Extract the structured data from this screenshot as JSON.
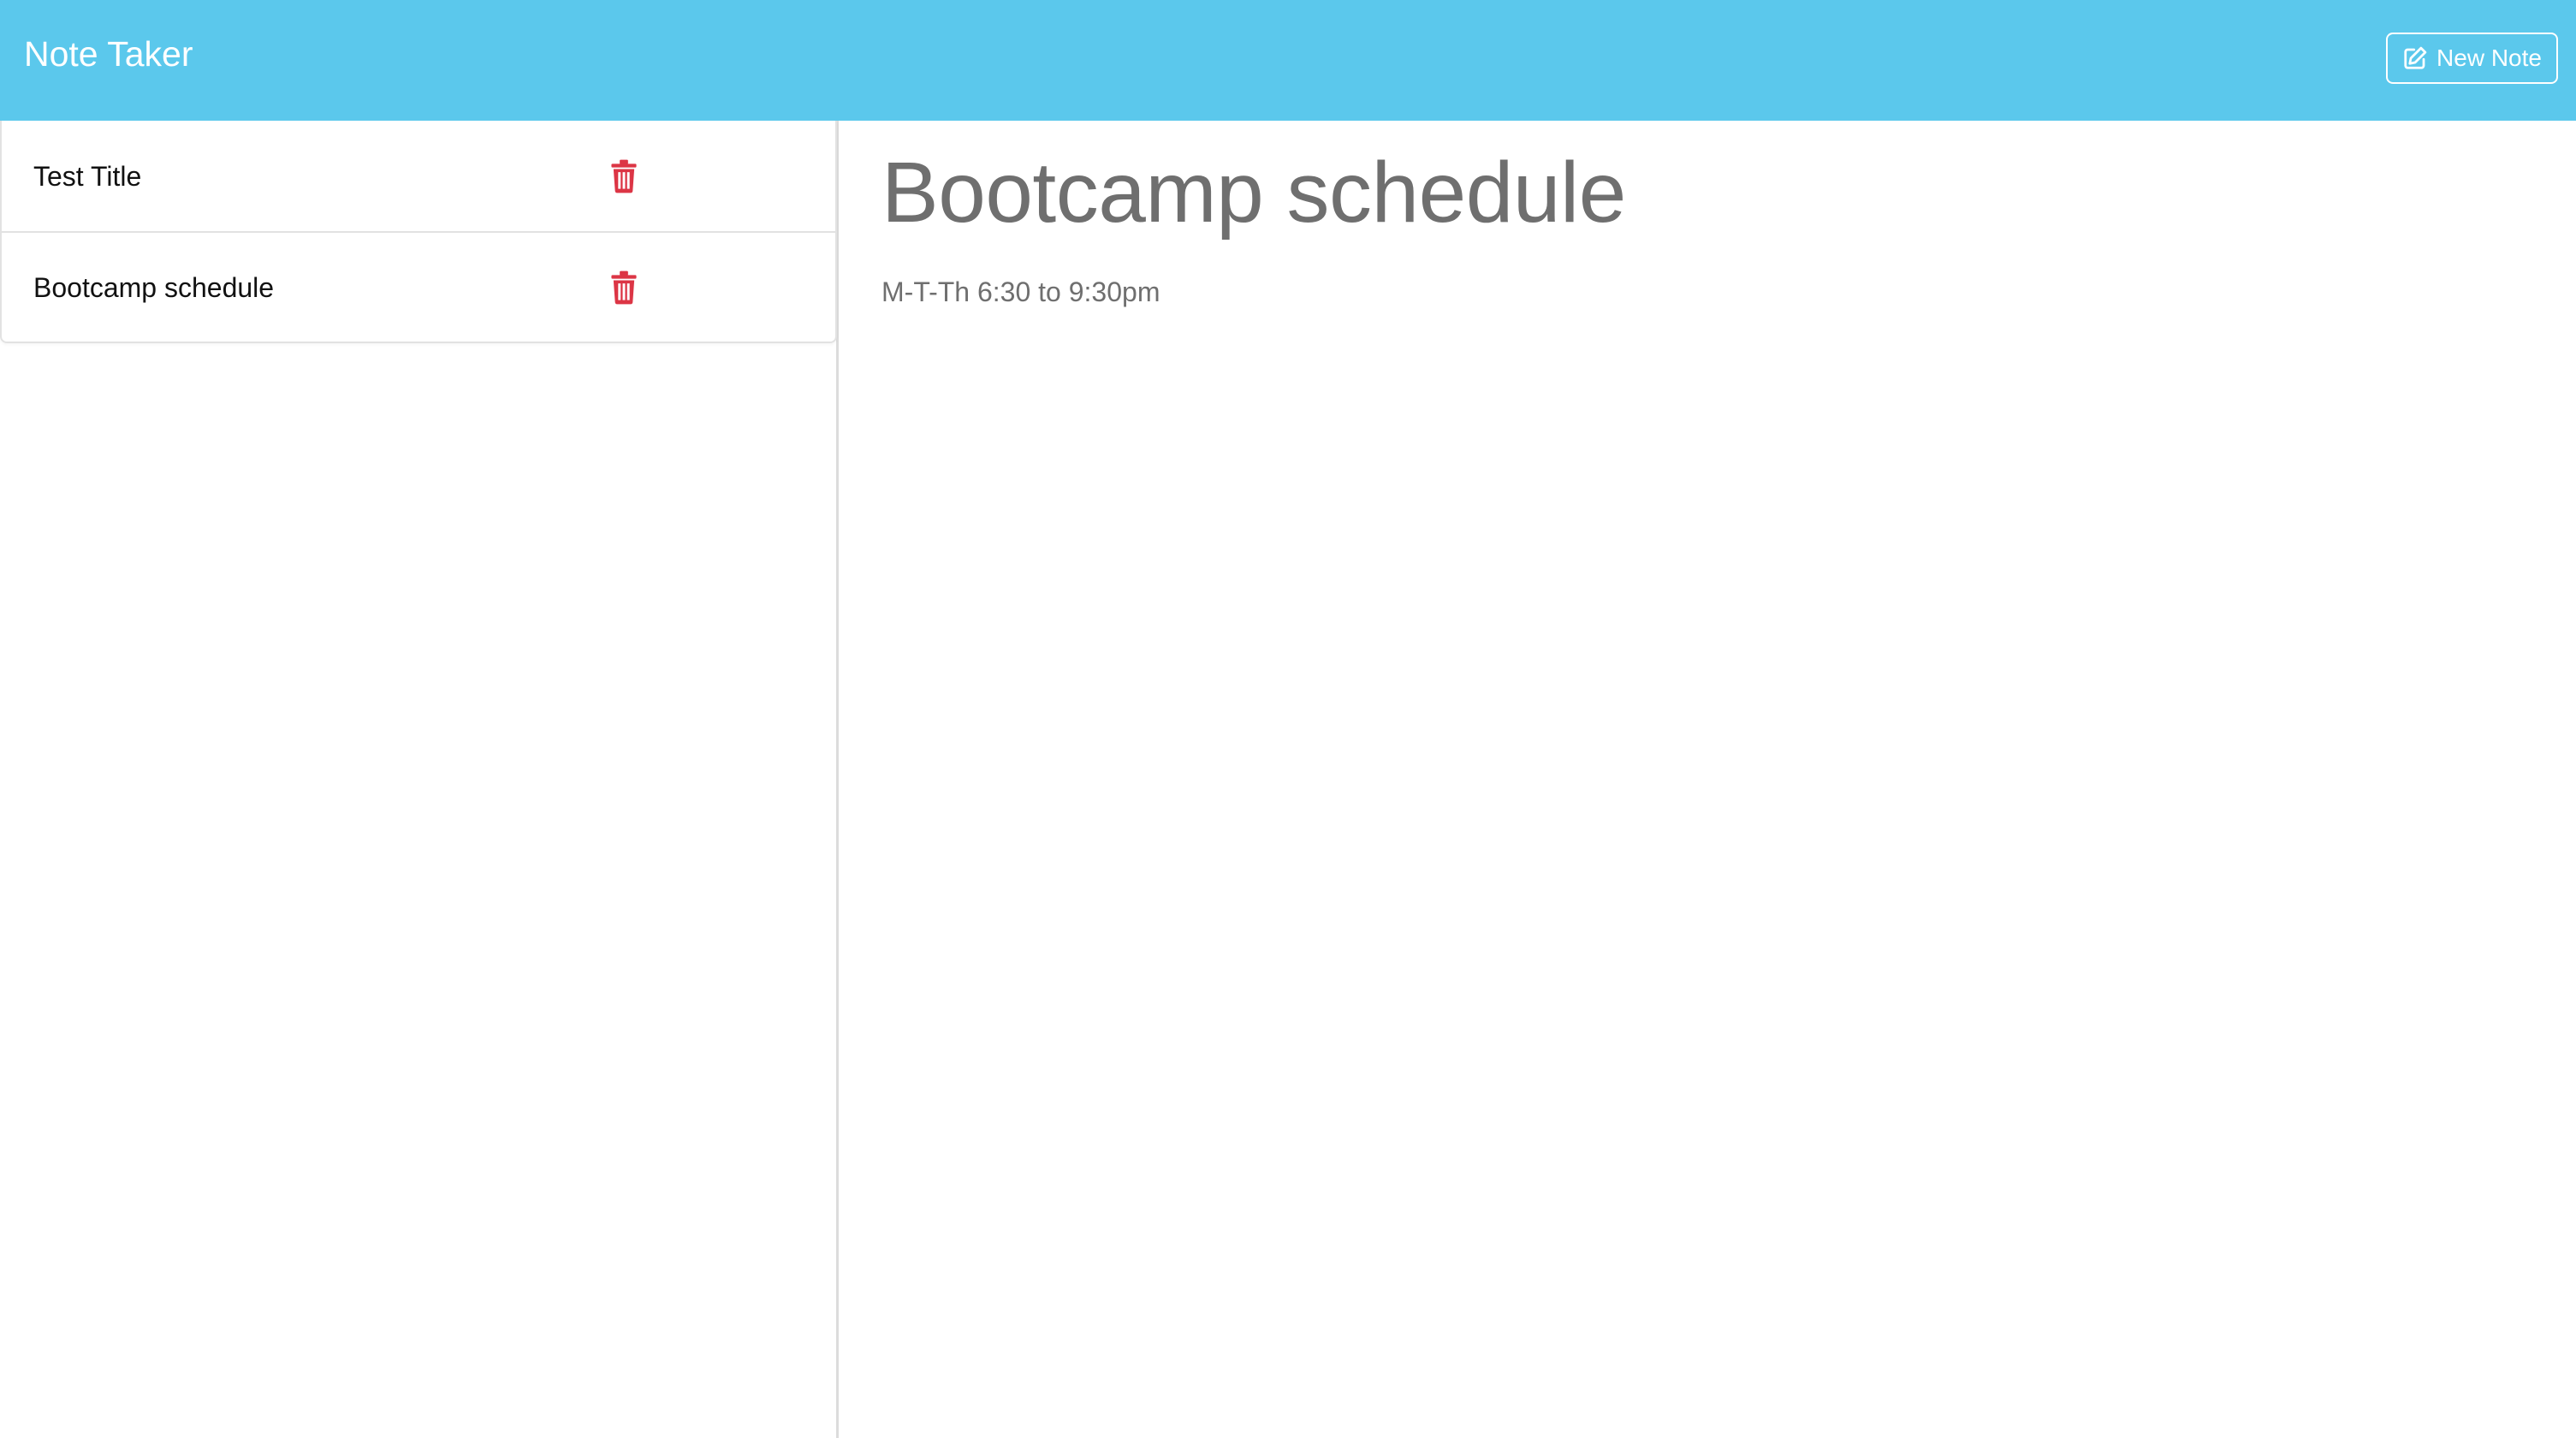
{
  "app": {
    "brand": "Note Taker",
    "new_note_label": "New Note",
    "new_note_icon": "edit-icon"
  },
  "sidebar": {
    "notes": [
      {
        "title": "Test Title",
        "icon": "trash-icon"
      },
      {
        "title": "Bootcamp schedule",
        "icon": "trash-icon"
      }
    ]
  },
  "main": {
    "title": "Bootcamp schedule",
    "text": "M-T-Th 6:30 to 9:30pm"
  },
  "colors": {
    "navbar": "#5bc8ec",
    "delete": "#dc3545",
    "note_text": "#6f6f6f"
  }
}
